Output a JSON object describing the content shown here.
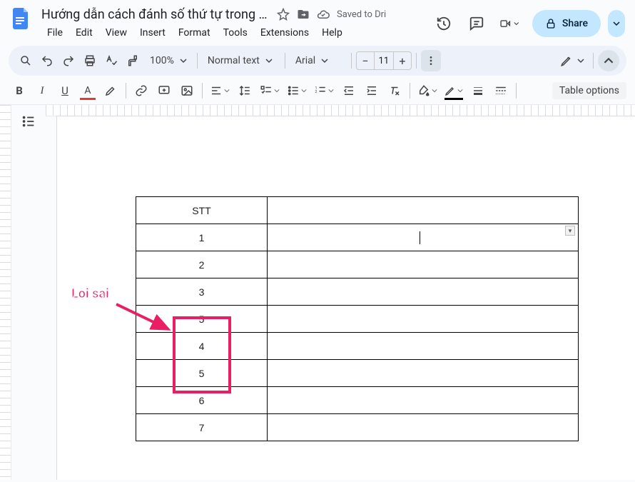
{
  "header": {
    "title": "Hướng dẫn cách đánh số thứ tự trong b...",
    "saved": "Saved to Dri",
    "share": "Share"
  },
  "menus": [
    "File",
    "Edit",
    "View",
    "Insert",
    "Format",
    "Tools",
    "Extensions",
    "Help"
  ],
  "toolbar": {
    "zoom": "100%",
    "style": "Normal text",
    "font": "Arial",
    "fontsize": "11",
    "table_options": "Table options"
  },
  "table": {
    "header": "STT",
    "rows": [
      "1",
      "2",
      "3",
      "5",
      "4",
      "5",
      "6",
      "7"
    ]
  },
  "annotation": {
    "label": "Lỗi sai"
  }
}
